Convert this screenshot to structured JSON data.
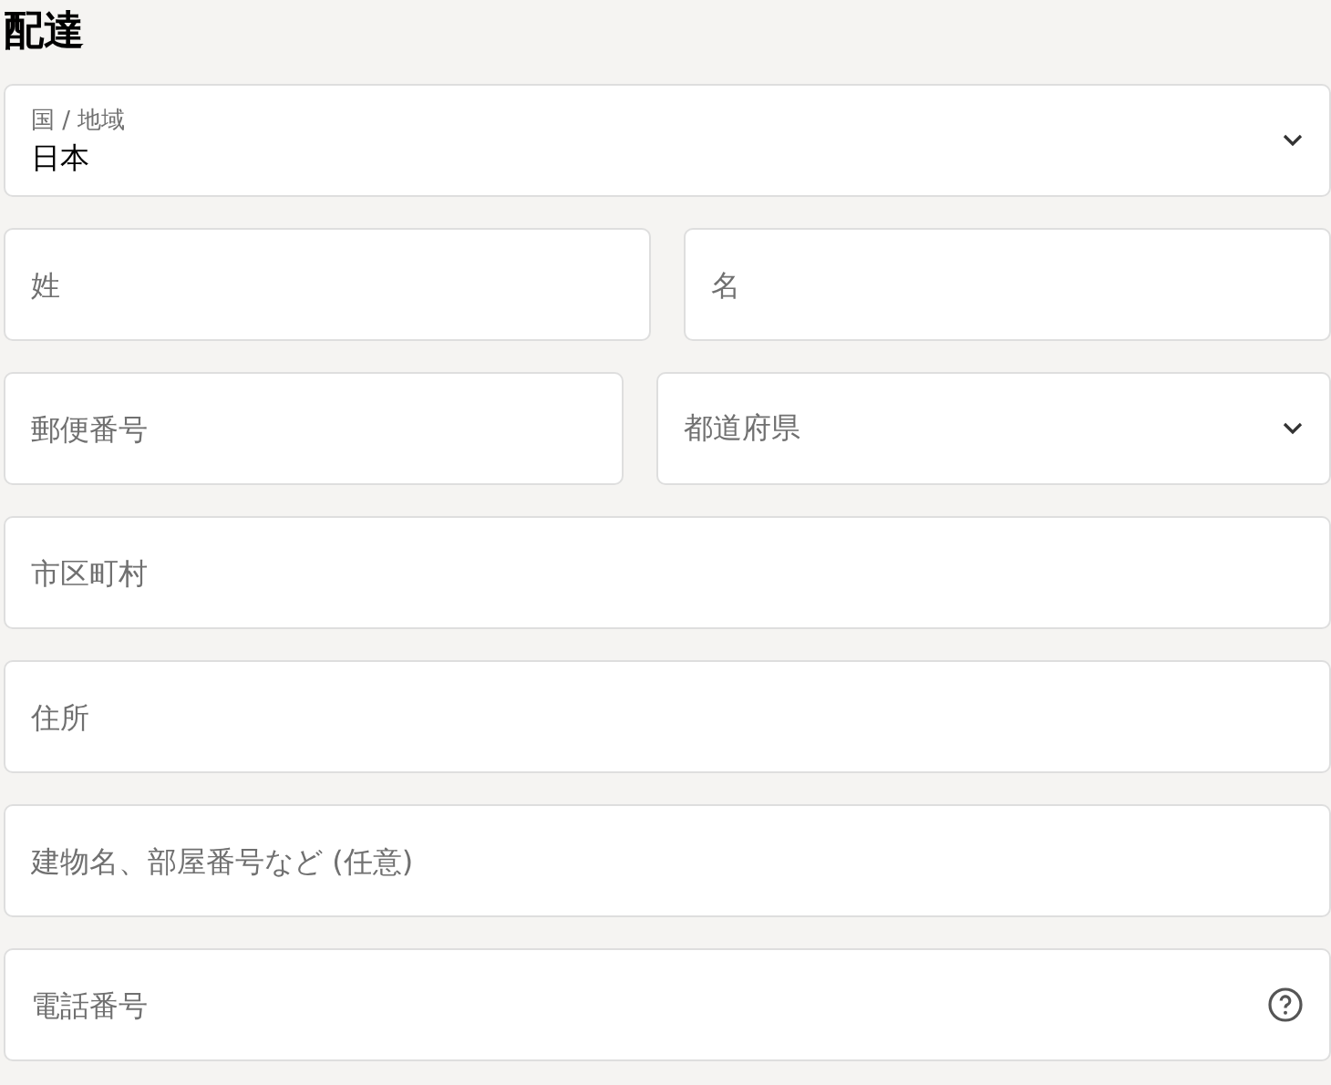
{
  "heading": "配達",
  "rows": [
    [
      {
        "kind": "select",
        "label": "国 / 地域",
        "value": "日本"
      }
    ],
    [
      {
        "kind": "input",
        "placeholder": "姓"
      },
      {
        "kind": "input",
        "placeholder": "名"
      }
    ],
    [
      {
        "kind": "input",
        "placeholder": "郵便番号"
      },
      {
        "kind": "select",
        "placeholder": "都道府県"
      }
    ],
    [
      {
        "kind": "input",
        "placeholder": "市区町村"
      }
    ],
    [
      {
        "kind": "input",
        "placeholder": "住所"
      }
    ],
    [
      {
        "kind": "input",
        "placeholder": "建物名、部屋番号など (任意)"
      }
    ],
    [
      {
        "kind": "input",
        "placeholder": "電話番号",
        "help": true
      }
    ]
  ]
}
